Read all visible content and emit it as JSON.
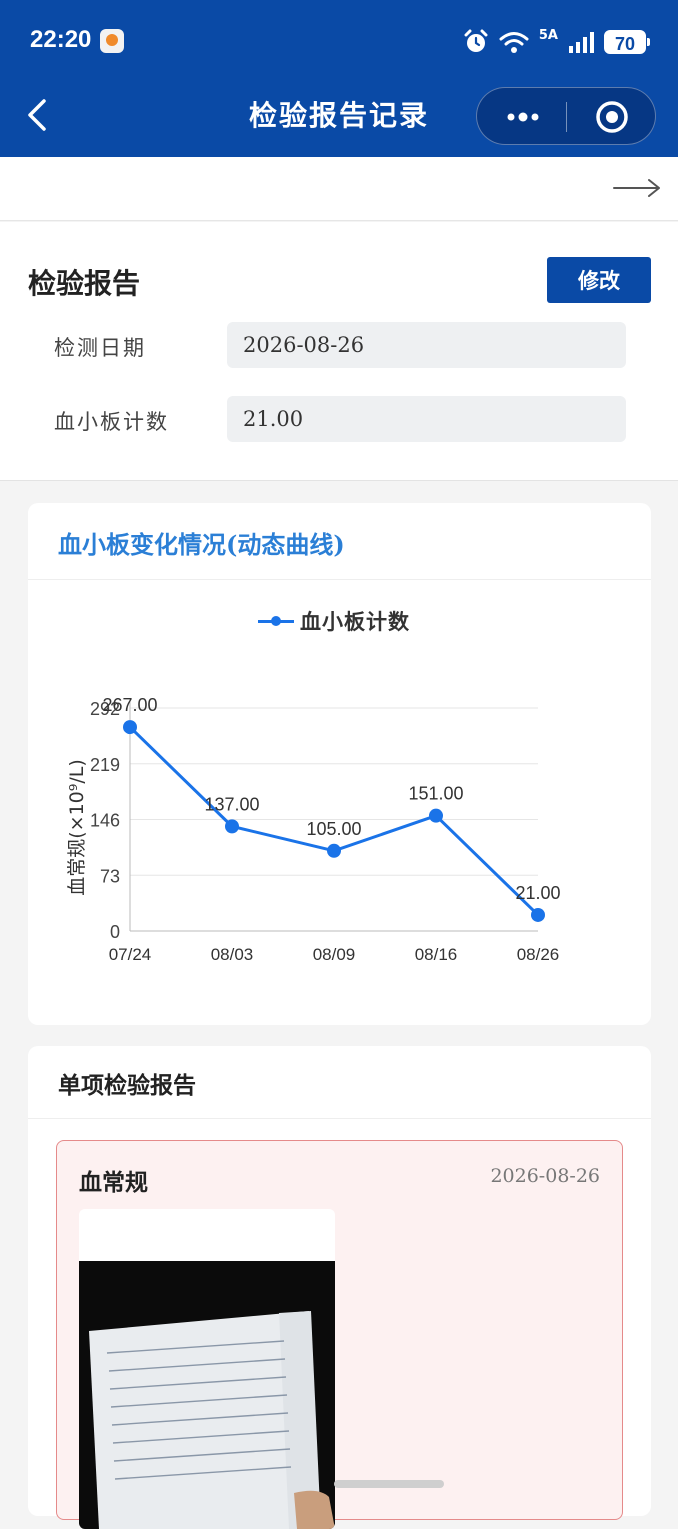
{
  "status_bar": {
    "time": "22:20",
    "network": "5A",
    "battery": "70"
  },
  "nav": {
    "title": "检验报告记录"
  },
  "report": {
    "title": "检验报告",
    "edit_button": "修改",
    "fields": [
      {
        "label": "检测日期",
        "value": "2026-08-26"
      },
      {
        "label": "血小板计数",
        "value": "21.00"
      }
    ]
  },
  "chart_section": {
    "title": "血小板变化情况(动态曲线)"
  },
  "chart_data": {
    "type": "line",
    "categories": [
      "07/24",
      "08/03",
      "08/09",
      "08/16",
      "08/26"
    ],
    "series": [
      {
        "name": "血小板计数",
        "values": [
          267.0,
          137.0,
          105.0,
          151.0,
          21.0
        ]
      }
    ],
    "data_labels": [
      "267.00",
      "137.00",
      "105.00",
      "151.00",
      "21.00"
    ],
    "ylabel": "血常规(×10⁹/L)",
    "yticks": [
      "0",
      "73",
      "146",
      "219",
      "292"
    ],
    "ylim": [
      0,
      292
    ],
    "grid": true,
    "legend": "top-center",
    "color": "#1a73e8"
  },
  "items_section": {
    "title": "单项检验报告",
    "items": [
      {
        "name": "血常规",
        "date": "2026-08-26"
      }
    ]
  }
}
